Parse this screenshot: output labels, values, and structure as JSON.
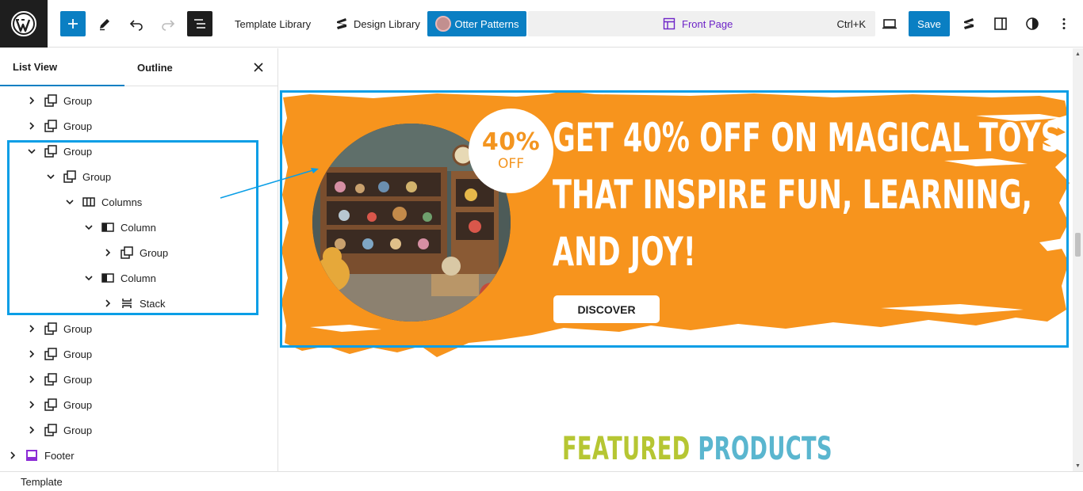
{
  "toolbar": {
    "template_library": "Template Library",
    "design_library": "Design Library",
    "otter_patterns": "Otter Patterns",
    "document_title": "Front Page",
    "shortcut": "Ctrl+K",
    "save_label": "Save"
  },
  "sidebar": {
    "tab_list_view": "List View",
    "tab_outline": "Outline",
    "items": [
      {
        "label": "Group",
        "expanded": false,
        "icon": "group-icon"
      },
      {
        "label": "Group",
        "expanded": false,
        "icon": "group-icon"
      },
      {
        "label": "Group",
        "expanded": true,
        "icon": "group-icon"
      },
      {
        "label": "Group",
        "expanded": true,
        "icon": "group-icon"
      },
      {
        "label": "Columns",
        "expanded": true,
        "icon": "columns-icon"
      },
      {
        "label": "Column",
        "expanded": true,
        "icon": "column-icon"
      },
      {
        "label": "Group",
        "expanded": false,
        "icon": "group-icon"
      },
      {
        "label": "Column",
        "expanded": true,
        "icon": "column-icon"
      },
      {
        "label": "Stack",
        "expanded": false,
        "icon": "stack-icon"
      },
      {
        "label": "Group",
        "expanded": false,
        "icon": "group-icon"
      },
      {
        "label": "Group",
        "expanded": false,
        "icon": "group-icon"
      },
      {
        "label": "Group",
        "expanded": false,
        "icon": "group-icon"
      },
      {
        "label": "Group",
        "expanded": false,
        "icon": "group-icon"
      },
      {
        "label": "Group",
        "expanded": false,
        "icon": "group-icon"
      },
      {
        "label": "Footer",
        "expanded": false,
        "icon": "footer-icon"
      }
    ]
  },
  "banner": {
    "percent": "40%",
    "off": "OFF",
    "headline_1": "GET 40% OFF ON MAGICAL TOYS",
    "headline_2": "THAT INSPIRE FUN, LEARNING,",
    "headline_3": "AND JOY!",
    "button": "DISCOVER"
  },
  "section": {
    "featured_word1": "FEATURED",
    "featured_word2": "PRODUCTS"
  },
  "status": {
    "breadcrumb": "Template"
  },
  "colors": {
    "accent": "#0a7fc3",
    "selection": "#0a9ee6",
    "banner_orange": "#f7941d",
    "featured_green": "#b6c633",
    "products_blue": "#5ab6cf",
    "template_purple": "#6d24c7"
  }
}
